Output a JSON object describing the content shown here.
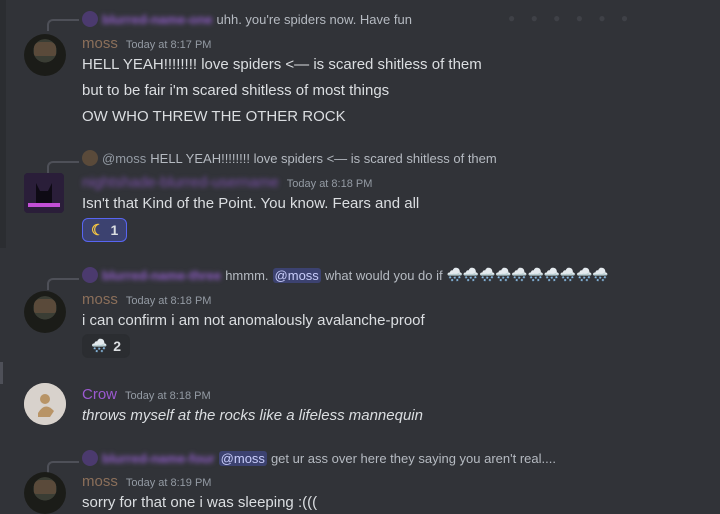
{
  "messages": [
    {
      "reply": {
        "author": "blurred-name-one",
        "text": "uhh. you're spiders now. Have fun"
      },
      "author": "moss",
      "author_color": "#8b6f5a",
      "time": "Today at 8:17 PM",
      "lines": [
        "HELL YEAH!!!!!!!! love spiders <— is scared shitless of them",
        "but to be fair i'm scared shitless of most things",
        "OW WHO THREW THE OTHER ROCK"
      ]
    },
    {
      "reply": {
        "mention": "@moss",
        "text": "HELL YEAH!!!!!!!! love spiders <— is scared shitless of them"
      },
      "author": "nightshade-blurred-username",
      "author_color": "#7a4fa8",
      "time": "Today at 8:18 PM",
      "lines": [
        "Isn't that Kind of the Point. You know. Fears and all"
      ],
      "reaction": {
        "emoji": "☾",
        "count": "1"
      }
    },
    {
      "reply": {
        "author": "blurred-name-three",
        "text_before": "hmmm.",
        "mention": "@moss",
        "text_after": "what would you do if",
        "emoji": "🌨️🌨️🌨️🌨️🌨️🌨️🌨️🌨️🌨️🌨️"
      },
      "author": "moss",
      "author_color": "#8b6f5a",
      "time": "Today at 8:18 PM",
      "lines": [
        "i can confirm i am not anomalously avalanche-proof"
      ],
      "reaction": {
        "emoji": "🌨️",
        "count": "2"
      }
    },
    {
      "author": "Crow",
      "author_color": "#9b59d0",
      "time": "Today at 8:18 PM",
      "lines": [
        "throws myself at the rocks like a lifeless mannequin"
      ]
    },
    {
      "reply": {
        "author": "blurred-name-four",
        "mention": "@moss",
        "text": "get ur ass over here they saying you aren't real...."
      },
      "author": "moss",
      "author_color": "#8b6f5a",
      "time": "Today at 8:19 PM",
      "lines": [
        "sorry for that one i was sleeping :((("
      ]
    }
  ]
}
